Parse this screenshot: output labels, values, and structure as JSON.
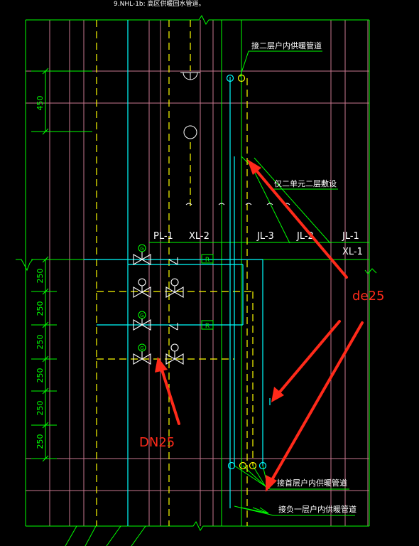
{
  "header_note": "9.NHL-1b: 高区供暖回水管道。",
  "labels": {
    "top_pipe": "接二层户内供暖管道",
    "unit_note": "仅二单元二层敷设",
    "pl1": "PL-1",
    "xl2": "XL-2",
    "jl3": "JL-3",
    "jl2": "JL-2",
    "jl1": "JL-1",
    "xl1": "XL-1",
    "first_floor": "接首层户内供暖管道",
    "basement_floor": "接负一层户内供暖管道"
  },
  "dimensions": {
    "top": "450",
    "d1": "250",
    "d2": "250",
    "d3": "250",
    "d4": "250",
    "d5": "250",
    "d6": "250"
  },
  "meter_label": "R",
  "annotations": {
    "de25": "de25",
    "dn25": "DN25"
  },
  "colors": {
    "background": "#000000",
    "frame": "#00ff00",
    "pink_grid": "#c87890",
    "supply_pipe": "#00ffff",
    "return_pipe": "#ffff00",
    "valve": "#ffffff",
    "annotation_red": "#ff2a1a"
  }
}
